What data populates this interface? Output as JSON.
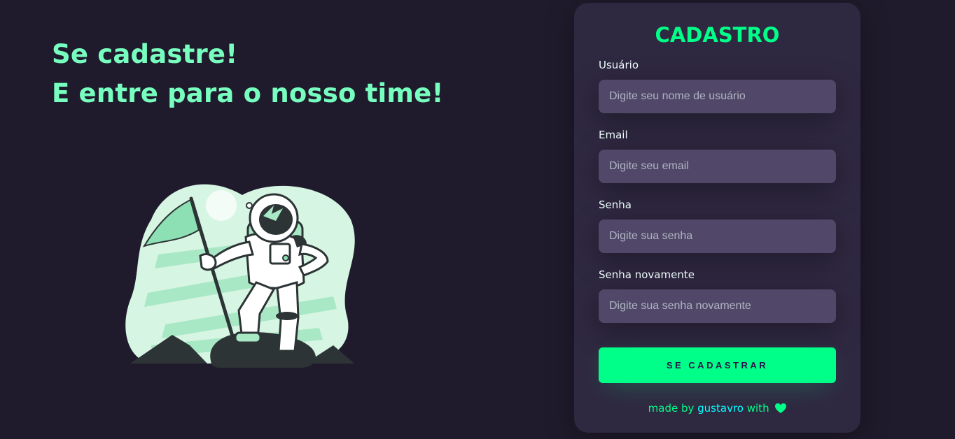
{
  "headline": {
    "line1": "Se cadastre!",
    "line2": "E entre para o nosso time!"
  },
  "illustration": {
    "name": "astronaut-with-flag-illustration"
  },
  "form": {
    "title": "CADASTRO",
    "fields": [
      {
        "label": "Usuário",
        "placeholder": "Digite seu nome de usuário",
        "value": ""
      },
      {
        "label": "Email",
        "placeholder": "Digite seu email",
        "value": ""
      },
      {
        "label": "Senha",
        "placeholder": "Digite sua senha",
        "value": ""
      },
      {
        "label": "Senha novamente",
        "placeholder": "Digite sua senha novamente",
        "value": ""
      }
    ],
    "submit_label": "SE CADASTRAR"
  },
  "footer": {
    "prefix": "made by",
    "author": "gustavro",
    "suffix": "with",
    "icon": "heart-icon"
  },
  "colors": {
    "background": "#201b2c",
    "card": "#2f2841",
    "input": "#514869",
    "accent": "#00ff88",
    "headline": "#77ffc0",
    "author_link": "#00ffff"
  }
}
